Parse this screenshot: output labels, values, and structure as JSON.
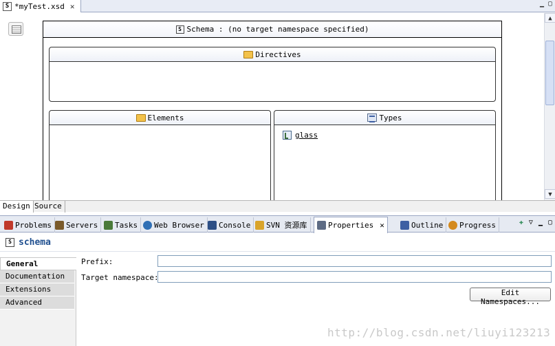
{
  "editor": {
    "tab_label": "*myTest.xsd",
    "tab_icon": "S"
  },
  "schema": {
    "header_icon": "S",
    "header_label": "Schema : (no target namespace specified)",
    "directives_label": "Directives",
    "elements_label": "Elements",
    "types_label": "Types",
    "types": [
      {
        "label": "glass"
      }
    ]
  },
  "design_tabs": [
    "Design",
    "Source"
  ],
  "view_tabs": [
    {
      "label": "Problems",
      "icon": "problems-icon",
      "color": "#c0392b"
    },
    {
      "label": "Servers",
      "icon": "servers-icon",
      "color": "#7a5a2a"
    },
    {
      "label": "Tasks",
      "icon": "tasks-icon",
      "color": "#4a7a3a"
    },
    {
      "label": "Web Browser",
      "icon": "globe-icon",
      "color": "#2f6fb5"
    },
    {
      "label": "Console",
      "icon": "console-icon",
      "color": "#2c4f86"
    },
    {
      "label": "SVN 资源库",
      "icon": "svn-icon",
      "color": "#d9a42b"
    },
    {
      "label": "Properties",
      "icon": "properties-icon",
      "color": "#5d6b84"
    },
    {
      "label": "Outline",
      "icon": "outline-icon",
      "color": "#3d5fa3"
    },
    {
      "label": "Progress",
      "icon": "progress-icon",
      "color": "#d48a1e"
    }
  ],
  "properties": {
    "title_icon": "S",
    "title": "schema",
    "sections": [
      "General",
      "Documentation",
      "Extensions",
      "Advanced"
    ],
    "active_section": "General",
    "prefix_label": "Prefix:",
    "prefix_value": "",
    "target_ns_label": "Target namespace:",
    "target_ns_value": "",
    "edit_namespaces_label": "Edit Namespaces..."
  },
  "watermark": "http://blog.csdn.net/liuyi123213"
}
